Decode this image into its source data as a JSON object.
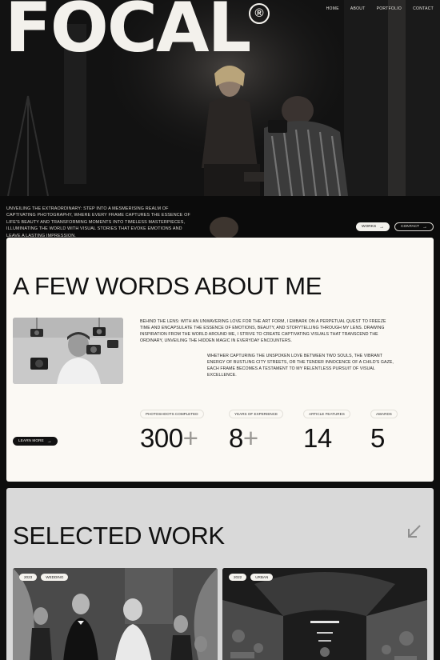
{
  "brand": {
    "logo": "FOCAL",
    "registered": "®"
  },
  "nav": {
    "items": [
      "HOME",
      "ABOUT",
      "PORTFOLIO",
      "CONTACT"
    ]
  },
  "hero": {
    "text": "UNVEILING THE EXTRAORDINARY: STEP INTO A MESMERISING REALM OF CAPTIVATING PHOTOGRAPHY, WHERE EVERY FRAME CAPTURES THE ESSENCE OF LIFE'S BEAUTY AND TRANSFORMING MOMENTS INTO TIMELESS MASTERPIECES, ILLUMINATING THE WORLD WITH VISUAL STORIES THAT EVOKE EMOTIONS AND LEAVE A LASTING IMPRESSION.",
    "works_label": "WORKS",
    "contact_label": "CONTACT"
  },
  "about": {
    "title": "A FEW WORDS ABOUT ME",
    "paragraph1": "BEHIND THE LENS: WITH AN UNWAVERING LOVE FOR THE ART FORM, I EMBARK ON A PERPETUAL QUEST TO FREEZE TIME AND ENCAPSULATE THE ESSENCE OF EMOTIONS, BEAUTY, AND STORYTELLING THROUGH MY LENS. DRAWING INSPIRATION FROM THE WORLD AROUND ME, I STRIVE TO CREATE CAPTIVATING VISUALS THAT TRANSCEND THE ORDINARY, UNVEILING THE HIDDEN MAGIC IN EVERYDAY ENCOUNTERS.",
    "paragraph2": "WHETHER CAPTURING THE UNSPOKEN LOVE BETWEEN TWO SOULS, THE VIBRANT ENERGY OF BUSTLING CITY STREETS, OR THE TENDER INNOCENCE OF A CHILD'S GAZE, EACH FRAME BECOMES A TESTAMENT TO MY RELENTLESS PURSUIT OF VISUAL EXCELLENCE.",
    "learn_more_label": "LEARN MORE",
    "stats": [
      {
        "label": "PHOTOSHOOTS COMPLETED",
        "value": "300",
        "plus": "+"
      },
      {
        "label": "YEARS OF EXPERIENCE",
        "value": "8",
        "plus": "+"
      },
      {
        "label": "ARTICLE FEATURES",
        "value": "14",
        "plus": ""
      },
      {
        "label": "AWARDS",
        "value": "5",
        "plus": ""
      }
    ]
  },
  "work": {
    "title": "SELECTED WORK",
    "cards": [
      {
        "year": "2023",
        "category": "WEDDING"
      },
      {
        "year": "2022",
        "category": "URBAN"
      }
    ]
  },
  "icons": {
    "arrow": "arrow-right-icon",
    "corner": "arrow-down-left-icon"
  },
  "colors": {
    "background": "#0e0e0e",
    "cream": "#fbf9f4",
    "gray_panel": "#d9d9d9",
    "ink": "#111111"
  }
}
